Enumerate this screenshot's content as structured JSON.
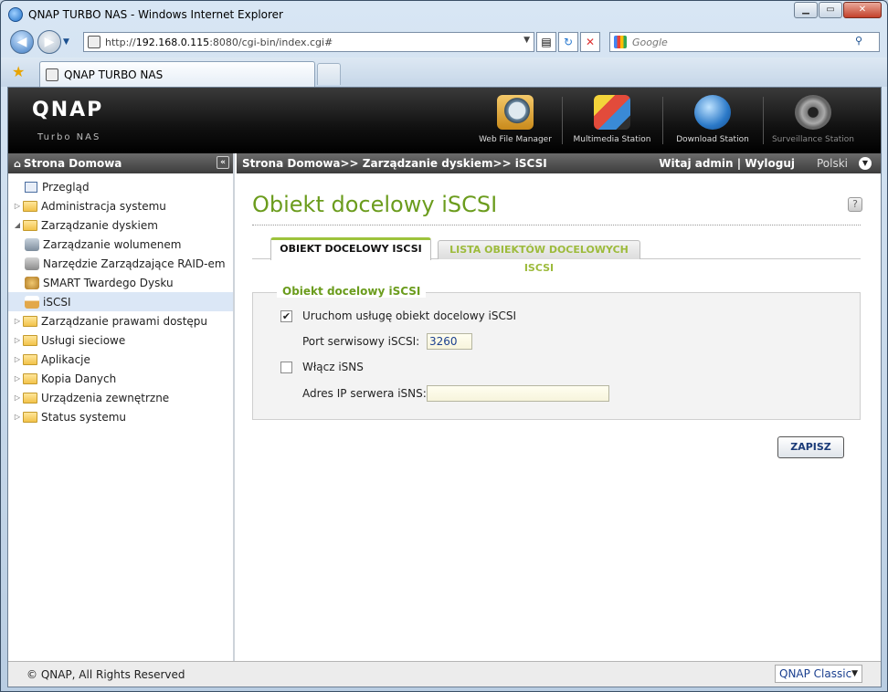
{
  "window": {
    "title": "QNAP TURBO NAS - Windows Internet Explorer"
  },
  "browser": {
    "url_prefix": "http://",
    "url_host": "192.168.0.115",
    "url_rest": ":8080/cgi-bin/index.cgi#",
    "search_placeholder": "Google",
    "tab_title": "QNAP TURBO NAS"
  },
  "header": {
    "logo": "QNAP",
    "logo_sub": "Turbo NAS",
    "apps": [
      {
        "label": "Web File Manager",
        "icon": "magnifier-folder-icon"
      },
      {
        "label": "Multimedia Station",
        "icon": "film-clapper-icon"
      },
      {
        "label": "Download Station",
        "icon": "globe-download-icon"
      },
      {
        "label": "Surveillance Station",
        "icon": "camera-icon"
      }
    ]
  },
  "sidebar": {
    "title": "Strona Domowa",
    "items": [
      {
        "label": "Przegląd",
        "type": "doc"
      },
      {
        "label": "Administracja systemu",
        "type": "folder"
      },
      {
        "label": "Zarządzanie dyskiem",
        "type": "folder-open"
      },
      {
        "label": "Zarządzanie wolumenem",
        "type": "sub"
      },
      {
        "label": "Narzędzie Zarządzające RAID-em",
        "type": "sub"
      },
      {
        "label": "SMART Twardego Dysku",
        "type": "sub"
      },
      {
        "label": "iSCSI",
        "type": "sub",
        "selected": true
      },
      {
        "label": "Zarządzanie prawami dostępu",
        "type": "folder"
      },
      {
        "label": "Usługi sieciowe",
        "type": "folder"
      },
      {
        "label": "Aplikacje",
        "type": "folder"
      },
      {
        "label": "Kopia Danych",
        "type": "folder"
      },
      {
        "label": "Urządzenia zewnętrzne",
        "type": "folder"
      },
      {
        "label": "Status systemu",
        "type": "folder"
      }
    ]
  },
  "breadcrumb": {
    "path": "Strona Domowa>> Zarządzanie dyskiem>> iSCSI",
    "welcome": "Witaj admin | Wyloguj",
    "language": "Polski"
  },
  "main": {
    "title": "Obiekt docelowy iSCSI",
    "help": "?",
    "tabs": [
      {
        "label": "OBIEKT DOCELOWY ISCSI",
        "active": true
      },
      {
        "label": "LISTA OBIEKTÓW DOCELOWYCH ISCSI",
        "active": false
      }
    ],
    "fieldset": {
      "legend": "Obiekt docelowy iSCSI",
      "enable_service_label": "Uruchom usługę obiekt docelowy iSCSI",
      "enable_service_checked": true,
      "port_label": "Port serwisowy iSCSI:",
      "port_value": "3260",
      "isns_label": "Włącz iSNS",
      "isns_checked": false,
      "isns_ip_label": "Adres IP serwera iSNS:",
      "isns_ip_value": ""
    },
    "save_label": "ZAPISZ"
  },
  "footer": {
    "copyright": "© QNAP, All Rights Reserved",
    "theme": "QNAP Classic"
  },
  "colors": {
    "accent_green": "#6b9c1d",
    "header_bg": "#111111"
  }
}
